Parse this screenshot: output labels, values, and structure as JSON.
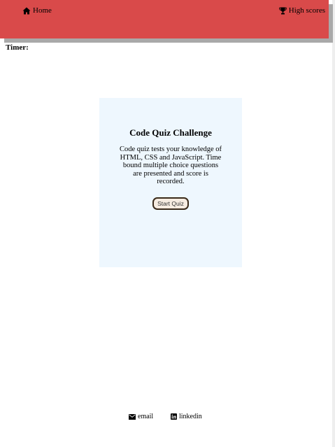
{
  "nav": {
    "home_label": "Home",
    "home_icon": "home-icon",
    "scores_label": "High scores",
    "scores_icon": "trophy-icon",
    "bar_color": "#d94a4a"
  },
  "timer": {
    "label": "Timer:"
  },
  "card": {
    "title": "Code Quiz Challenge",
    "description": "Code quiz tests your knowledge of HTML, CSS and JavaScript. Time bound multiple choice questions are presented and score is recorded.",
    "start_label": "Start Quiz",
    "background": "#eef7fe"
  },
  "footer": {
    "email_label": "email",
    "email_icon": "envelope-icon",
    "linkedin_label": "linkedin",
    "linkedin_icon": "linkedin-icon"
  }
}
